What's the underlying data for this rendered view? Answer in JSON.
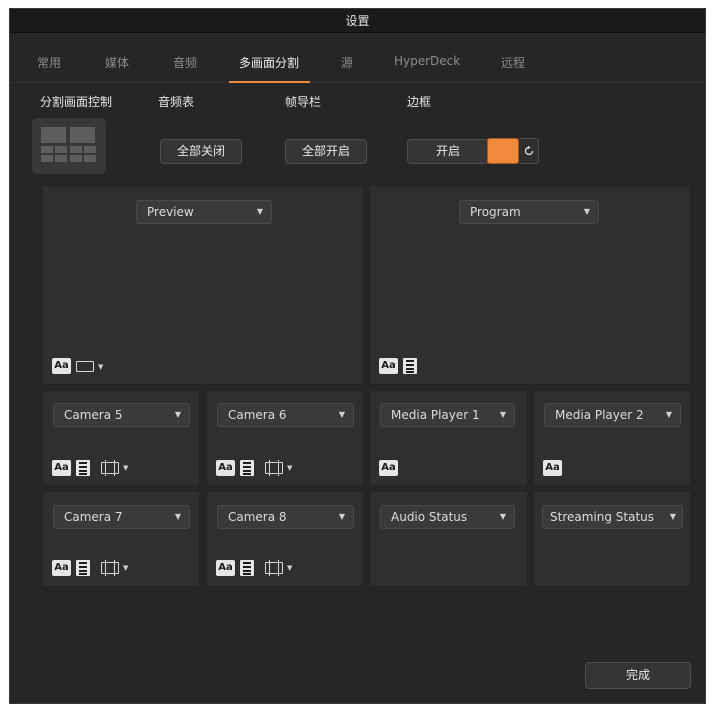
{
  "window": {
    "title": "设置"
  },
  "tabs": [
    {
      "label": "常用"
    },
    {
      "label": "媒体"
    },
    {
      "label": "音频"
    },
    {
      "label": "多画面分割"
    },
    {
      "label": "源"
    },
    {
      "label": "HyperDeck"
    },
    {
      "label": "远程"
    }
  ],
  "active_tab": "多画面分割",
  "controls": {
    "layout_label": "分割画面控制",
    "audio_meters_label": "音频表",
    "audio_meters_button": "全部关闭",
    "tally_label": "帧导栏",
    "tally_button": "全部开启",
    "border_label": "边框",
    "border_button": "开启",
    "border_color": "#f08a3c"
  },
  "views": {
    "preview": {
      "source": "Preview"
    },
    "program": {
      "source": "Program"
    },
    "small": [
      {
        "source": "Camera 5"
      },
      {
        "source": "Camera 6"
      },
      {
        "source": "Media Player 1"
      },
      {
        "source": "Media Player 2"
      },
      {
        "source": "Camera 7"
      },
      {
        "source": "Camera 8"
      },
      {
        "source": "Audio Status"
      },
      {
        "source": "Streaming Status"
      }
    ]
  },
  "icons": {
    "label_toggle": "Aa"
  },
  "footer": {
    "done_label": "完成"
  },
  "colors": {
    "accent": "#f08a3c",
    "background": "#262626",
    "panel": "#2f2f2f"
  }
}
